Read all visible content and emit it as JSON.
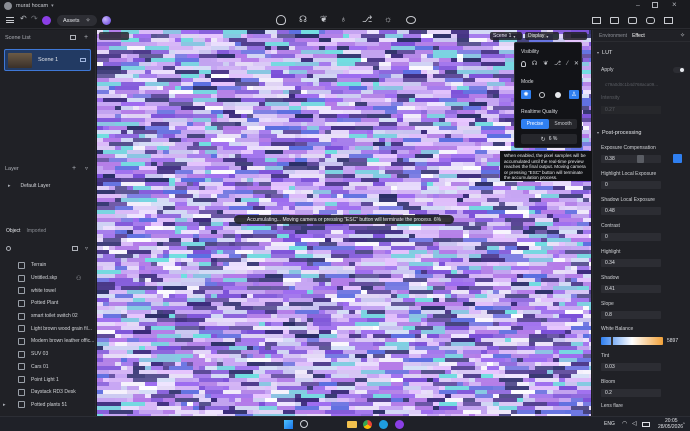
{
  "titlebar": {
    "user": "murat hocam"
  },
  "toolbar": {
    "assets_label": "Assets"
  },
  "left_panel": {
    "scene_list_title": "Scene List",
    "scenes": [
      {
        "label": "Scene 1"
      }
    ],
    "layer_title": "Layer",
    "layers": [
      {
        "label": "Default Layer"
      }
    ],
    "tabs": {
      "object": "Object",
      "imported": "Imported"
    },
    "objects": [
      {
        "label": "Terrain"
      },
      {
        "label": "Untitled.skp"
      },
      {
        "label": "white towel"
      },
      {
        "label": "Potted Plant"
      },
      {
        "label": "smart toilet switch 02"
      },
      {
        "label": "Light brown wood grain fil..."
      },
      {
        "label": "Modern brown leather offic..."
      },
      {
        "label": "SUV 03"
      },
      {
        "label": "Cars 01"
      },
      {
        "label": "Point Light 1"
      },
      {
        "label": "Daystack RD3 Desk"
      },
      {
        "label": "Potted plants 51"
      }
    ]
  },
  "viewport": {
    "scene_dropdown": "Scene 1",
    "display_dropdown": "Display",
    "accumulating_message": "Accumulating... Moving camera or pressing \"ESC\" button will terminate the process. 6%"
  },
  "popup": {
    "visibility_title": "Visibility",
    "mode_title": "Mode",
    "realtime_quality_title": "Realtime Quality",
    "quality_options": [
      "Precise",
      "Smooth"
    ],
    "progress_text": "6 %",
    "tooltip": "When enabled, the pixel samples will be accumulated until the real-time preview reaches the final output. Moving camera or pressing \"ESC\" button will terminate the accumulation process."
  },
  "right_panel": {
    "tabs": {
      "environment": "Environment",
      "effect": "Effect"
    },
    "lut_title": "LUT",
    "apply_label": "Apply",
    "lut_file": "c79a0d0c1b4d768aca09...",
    "intensity_label": "Intensity",
    "intensity_value": "0.27",
    "postprocessing_title": "Post-processing",
    "params": [
      {
        "label": "Exposure Compensation",
        "value": "0.38"
      },
      {
        "label": "Highlight Local Exposure",
        "value": "0"
      },
      {
        "label": "Shadow Local Exposure",
        "value": "0.48"
      },
      {
        "label": "Contrast",
        "value": "0"
      },
      {
        "label": "Highlight",
        "value": "0.34"
      },
      {
        "label": "Shadow",
        "value": "0.41"
      },
      {
        "label": "Slope",
        "value": "0.8"
      }
    ],
    "white_balance_label": "White Balance",
    "white_balance_value": "5897",
    "params2": [
      {
        "label": "Tint",
        "value": "0.03"
      },
      {
        "label": "Bloom",
        "value": "0.2"
      }
    ],
    "lens_flare_label": "Lens flare"
  },
  "taskbar": {
    "language": "ENG",
    "time": "20:05",
    "date": "28/05/2026"
  },
  "colors": {
    "accent": "#2f7ff0",
    "panel": "#202126",
    "viewport_purple": "#b79be7"
  }
}
